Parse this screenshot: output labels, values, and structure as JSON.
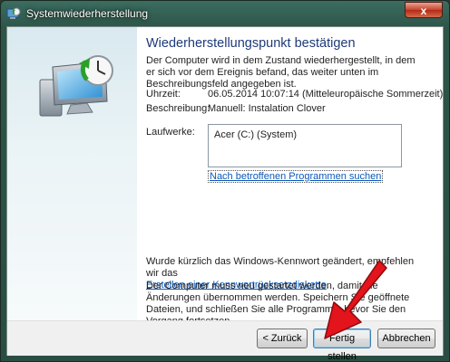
{
  "window": {
    "title": "Systemwiederherstellung",
    "close_glyph": "x"
  },
  "main": {
    "heading": "Wiederherstellungspunkt bestätigen",
    "description": "Der Computer wird in dem Zustand wiederhergestellt, in dem er sich vor dem Ereignis befand, das weiter unten im Beschreibungsfeld angegeben ist.",
    "time_label": "Uhrzeit:",
    "time_value": "06.05.2014 10:07:14 (Mitteleuropäische Sommerzeit)",
    "description_label": "Beschreibung:",
    "description_value": "Manuell: Instalation Clover",
    "drives_label": "Laufwerke:",
    "drives_items": [
      "Acer (C:) (System)"
    ],
    "affected_programs_link": "Nach betroffenen Programmen suchen",
    "password_note": "Wurde kürzlich das Windows-Kennwort geändert, empfehlen wir das",
    "password_reset_link": "Erstellen einer Kennwortrücksetzdiskette",
    "password_note_end": ".",
    "restart_note": "Der Computer muss neu gestartet werden, damit die Änderungen übernommen werden. Speichern Sie geöffnete Dateien, und schließen Sie alle Programme, bevor Sie den Vorgang fortsetzen."
  },
  "buttons": {
    "back": "< Zurück",
    "finish": "Fertig stellen",
    "cancel": "Abbrechen"
  },
  "colors": {
    "heading": "#1f3a7a",
    "link": "#0b58b8",
    "arrow": "#e3141b",
    "sidebar": "#dcebf0"
  },
  "icons": {
    "hero": "monitor-restore-clock-icon",
    "title": "system-restore-icon",
    "annotation": "red-arrow-icon"
  }
}
